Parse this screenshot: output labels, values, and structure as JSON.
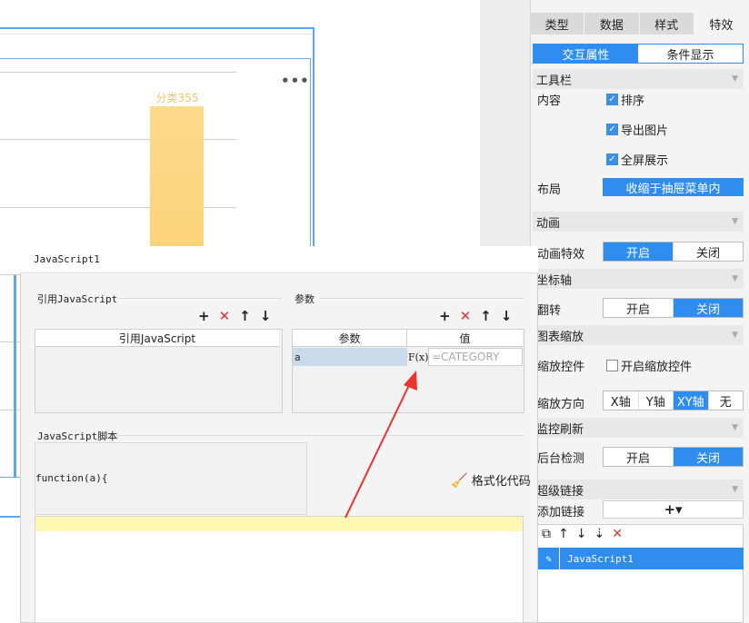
{
  "chart": {
    "bar_label": "分类355",
    "more": "•••"
  },
  "right_panel": {
    "tabs": [
      "类型",
      "数据",
      "样式",
      "特效"
    ],
    "subtabs": [
      "交互属性",
      "条件显示"
    ],
    "toolbar_section": "工具栏",
    "content_label": "内容",
    "checks": [
      "排序",
      "导出图片",
      "全屏展示"
    ],
    "layout_label": "布局",
    "layout_value": "收缩于抽屉菜单内",
    "animation_section": "动画",
    "animation_label": "动画特效",
    "on": "开启",
    "off": "关闭",
    "axis_section": "坐标轴",
    "flip_label": "翻转",
    "zoom_section": "图表缩放",
    "zoom_control_label": "缩放控件",
    "zoom_control_check": "开启缩放控件",
    "zoom_dir_label": "缩放方向",
    "zoom_dirs": [
      "X轴",
      "Y轴",
      "XY轴",
      "无"
    ],
    "monitor_section": "监控刷新",
    "bg_detect_label": "后台检测",
    "hyperlink_section": "超级链接",
    "add_link_label": "添加链接",
    "add_link_btn": "+▾",
    "link_item": "JavaScript1"
  },
  "dialog": {
    "title": "JavaScript1",
    "ref_js_group": "引用JavaScript",
    "params_group": "参数",
    "ref_js_col": "引用JavaScript",
    "param_col": "参数",
    "value_col": "值",
    "param_name": "a",
    "fx": "F(x)",
    "value_placeholder": "=CATEGORY",
    "script_group": "JavaScript脚本",
    "script_head": "function(a){",
    "format_code": "格式化代码"
  }
}
